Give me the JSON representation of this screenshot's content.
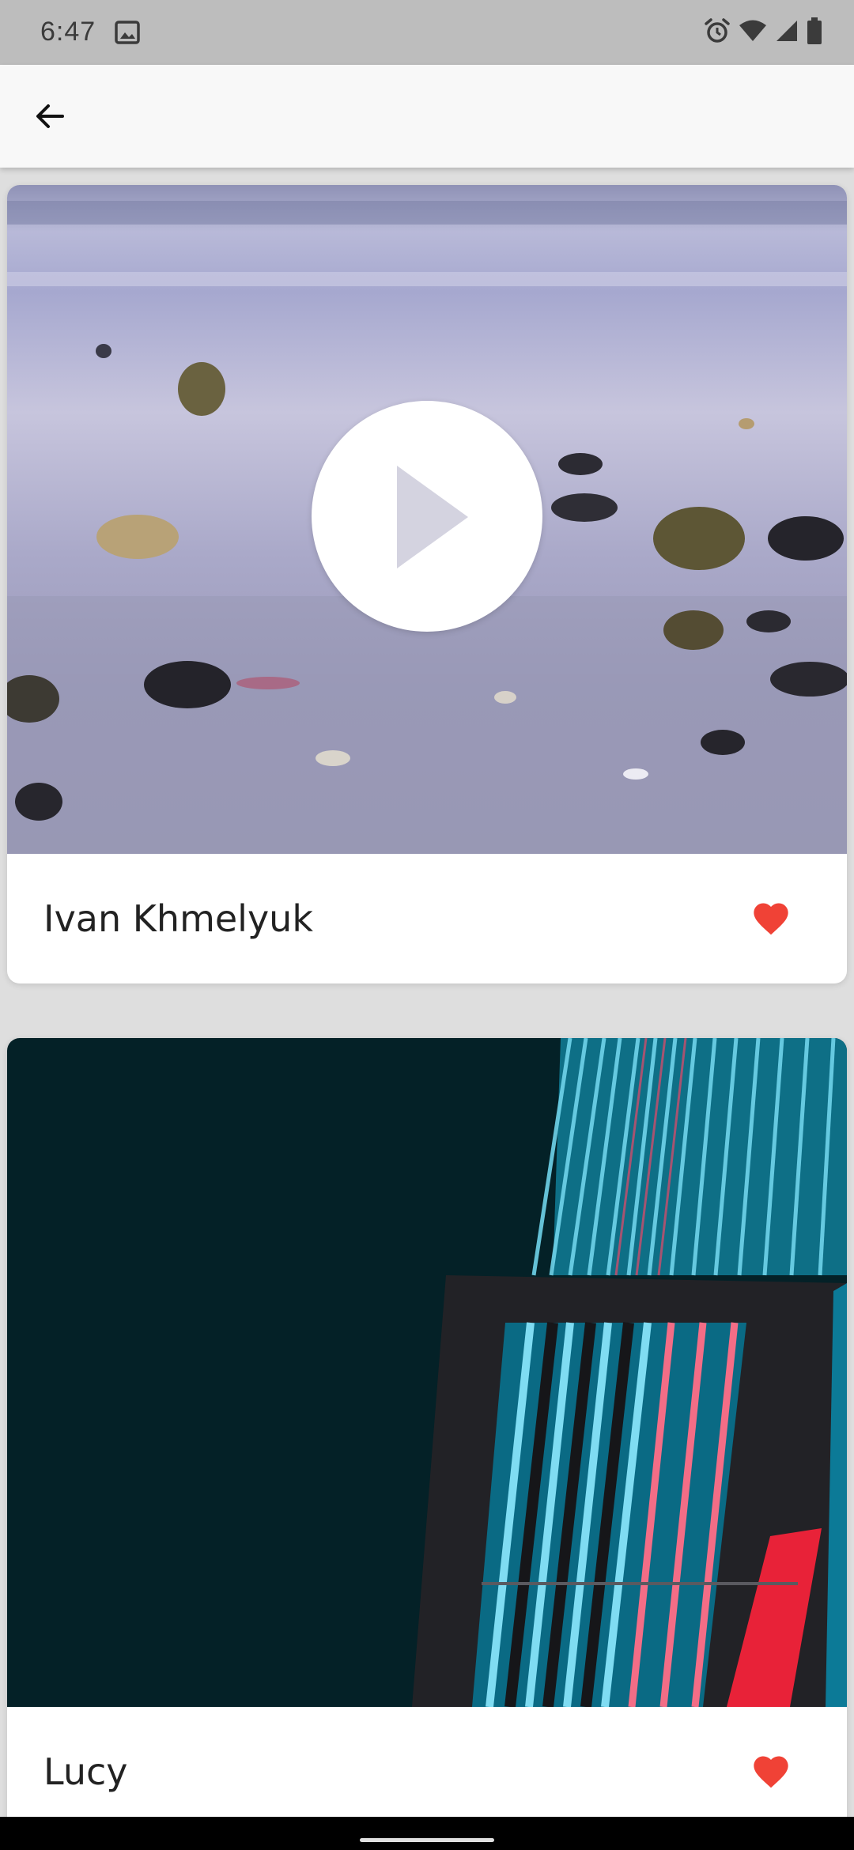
{
  "status_bar": {
    "time": "6:47",
    "icons": [
      "gallery-icon",
      "alarm-icon",
      "wifi-icon",
      "signal-icon",
      "battery-icon"
    ]
  },
  "app_bar": {
    "back_icon": "arrow-back-icon"
  },
  "feed": {
    "items": [
      {
        "name": "Ivan Khmelyuk",
        "thumbnail": "beach shells photo",
        "type": "video",
        "play_icon": "play-icon",
        "favorite": true,
        "favorite_icon": "heart-icon"
      },
      {
        "name": "Lucy",
        "thumbnail": "neon lights photo",
        "type": "image",
        "favorite": true,
        "favorite_icon": "heart-icon"
      }
    ]
  },
  "colors": {
    "status_bar": "#bdbdbd",
    "app_bar": "#f8f8f8",
    "background": "#dedede",
    "card": "#ffffff",
    "heart": "#f04236",
    "text": "#222222"
  }
}
